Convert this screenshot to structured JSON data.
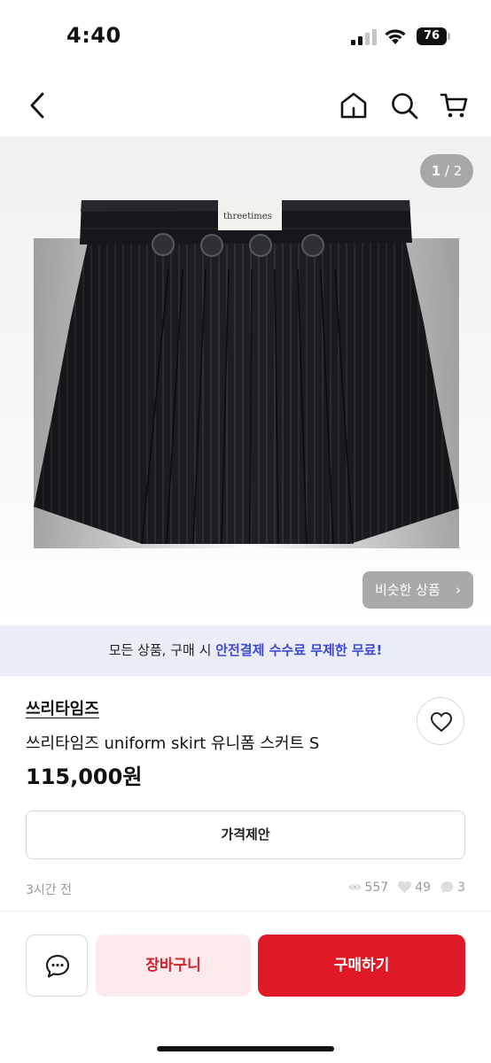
{
  "status_bar": {
    "time": "4:40",
    "battery": "76"
  },
  "nav": {
    "back_icon": "chevron-left-icon",
    "home_icon": "home-icon",
    "search_icon": "search-icon",
    "cart_icon": "cart-icon"
  },
  "gallery": {
    "current_page": "1",
    "separator": " / ",
    "total_pages": "2",
    "label_text": "threetimes",
    "similar_button_label": "비슷한 상품",
    "similar_button_icon": "chevron-right-icon"
  },
  "banner": {
    "text_prefix": "모든 상품, 구매 시 ",
    "text_highlight": "안전결제 수수료 무제한 무료!",
    "highlight_color": "#3d49d6"
  },
  "product": {
    "seller": "쓰리타임즈",
    "title": "쓰리타임즈 uniform skirt 유니폼 스커트 S",
    "price": "115,000원",
    "offer_button_label": "가격제안",
    "posted": "3시간 전",
    "views": "557",
    "likes": "49",
    "chats": "3"
  },
  "actions": {
    "chat_icon": "chat-icon",
    "like_icon": "heart-icon",
    "cart_label": "장바구니",
    "buy_label": "구매하기",
    "buy_color": "#df1a26",
    "cart_bg_color": "#fdeaec"
  }
}
